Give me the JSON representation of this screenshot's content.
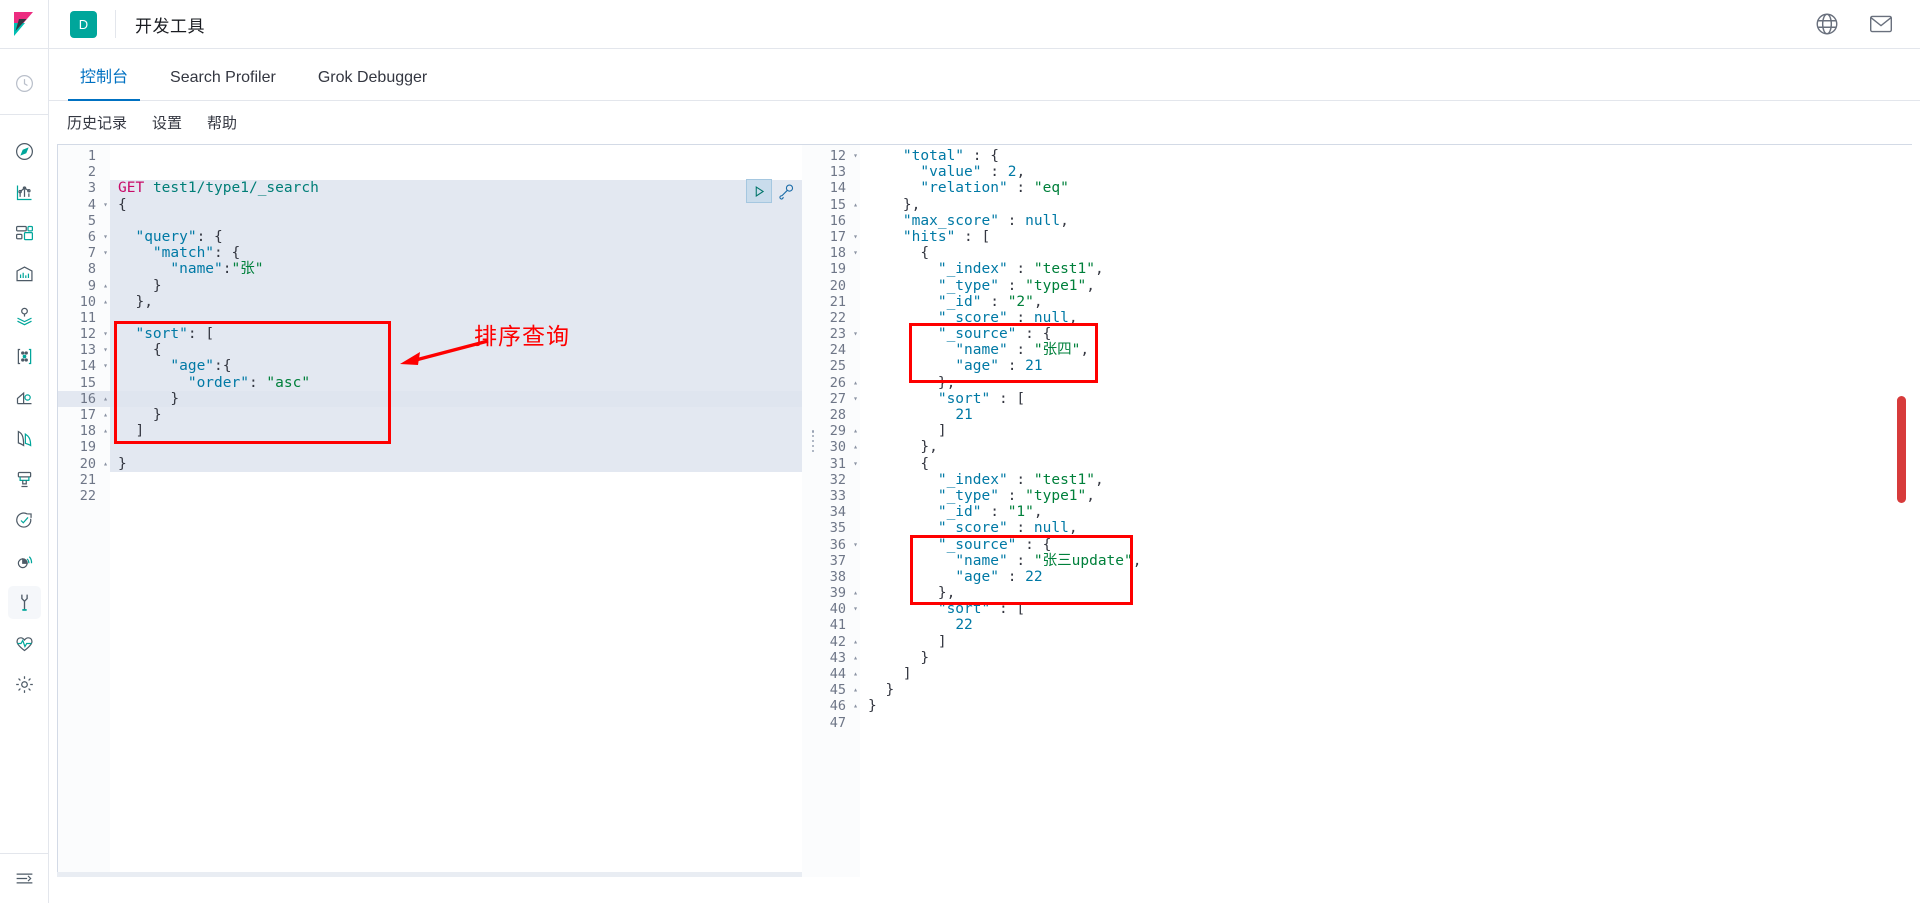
{
  "header": {
    "logo_icon": "kibana-logo",
    "space_badge": "D",
    "app_title": "开发工具",
    "right_icons": [
      {
        "name": "help-globe-icon",
        "glyph": "help"
      },
      {
        "name": "mail-icon",
        "glyph": "mail"
      }
    ]
  },
  "sidebar": {
    "recent_icon": "recently-viewed-clock-icon",
    "items": [
      {
        "name": "discover-icon",
        "label": "Discover"
      },
      {
        "name": "visualize-icon",
        "label": "Visualize"
      },
      {
        "name": "dashboard-icon",
        "label": "Dashboard"
      },
      {
        "name": "canvas-icon",
        "label": "Canvas"
      },
      {
        "name": "maps-icon",
        "label": "Maps"
      },
      {
        "name": "machine-learning-icon",
        "label": "Machine Learning"
      },
      {
        "name": "infrastructure-icon",
        "label": "Infrastructure"
      },
      {
        "name": "logs-icon",
        "label": "Logs"
      },
      {
        "name": "apm-icon",
        "label": "APM"
      },
      {
        "name": "uptime-icon",
        "label": "Uptime"
      },
      {
        "name": "siem-icon",
        "label": "SIEM"
      },
      {
        "name": "dev-tools-wrench-icon",
        "label": "开发工具",
        "active": true
      },
      {
        "name": "monitoring-heartbeat-icon",
        "label": "Monitoring"
      },
      {
        "name": "management-gear-icon",
        "label": "Management"
      }
    ],
    "collapse_icon": "collapse-menu-icon"
  },
  "tabs": [
    {
      "label": "控制台",
      "name": "tab-console",
      "active": true
    },
    {
      "label": "Search Profiler",
      "name": "tab-search-profiler",
      "active": false
    },
    {
      "label": "Grok Debugger",
      "name": "tab-grok-debugger",
      "active": false
    }
  ],
  "submenu": [
    {
      "label": "历史记录",
      "name": "submenu-history"
    },
    {
      "label": "设置",
      "name": "submenu-settings"
    },
    {
      "label": "帮助",
      "name": "submenu-help"
    }
  ],
  "request_editor": {
    "play_icon": "play-run-request-icon",
    "wrench_icon": "wrench-options-icon",
    "highlighted_line": 16,
    "lines": [
      {
        "n": 1,
        "fold": "",
        "text": ""
      },
      {
        "n": 2,
        "fold": "",
        "text": ""
      },
      {
        "n": 3,
        "fold": "",
        "text": "GET test1/type1/_search",
        "kind": "request"
      },
      {
        "n": 4,
        "fold": "v",
        "text": "{"
      },
      {
        "n": 5,
        "fold": "",
        "text": ""
      },
      {
        "n": 6,
        "fold": "v",
        "text": "  \"query\": {"
      },
      {
        "n": 7,
        "fold": "v",
        "text": "    \"match\": {"
      },
      {
        "n": 8,
        "fold": "",
        "text": "      \"name\":\"张\""
      },
      {
        "n": 9,
        "fold": "^",
        "text": "    }"
      },
      {
        "n": 10,
        "fold": "^",
        "text": "  },"
      },
      {
        "n": 11,
        "fold": "",
        "text": ""
      },
      {
        "n": 12,
        "fold": "v",
        "text": "  \"sort\": ["
      },
      {
        "n": 13,
        "fold": "v",
        "text": "    {"
      },
      {
        "n": 14,
        "fold": "v",
        "text": "      \"age\":{"
      },
      {
        "n": 15,
        "fold": "",
        "text": "        \"order\": \"asc\""
      },
      {
        "n": 16,
        "fold": "^",
        "text": "      }"
      },
      {
        "n": 17,
        "fold": "^",
        "text": "    }"
      },
      {
        "n": 18,
        "fold": "^",
        "text": "  ]"
      },
      {
        "n": 19,
        "fold": "",
        "text": ""
      },
      {
        "n": 20,
        "fold": "^",
        "text": "}"
      },
      {
        "n": 21,
        "fold": "",
        "text": ""
      },
      {
        "n": 22,
        "fold": "",
        "text": ""
      }
    ]
  },
  "response_editor": {
    "lines": [
      {
        "n": 12,
        "fold": "v",
        "text": "    \"total\" : {"
      },
      {
        "n": 13,
        "fold": "",
        "text": "      \"value\" : 2,"
      },
      {
        "n": 14,
        "fold": "",
        "text": "      \"relation\" : \"eq\""
      },
      {
        "n": 15,
        "fold": "^",
        "text": "    },"
      },
      {
        "n": 16,
        "fold": "",
        "text": "    \"max_score\" : null,"
      },
      {
        "n": 17,
        "fold": "v",
        "text": "    \"hits\" : ["
      },
      {
        "n": 18,
        "fold": "v",
        "text": "      {"
      },
      {
        "n": 19,
        "fold": "",
        "text": "        \"_index\" : \"test1\","
      },
      {
        "n": 20,
        "fold": "",
        "text": "        \"_type\" : \"type1\","
      },
      {
        "n": 21,
        "fold": "",
        "text": "        \"_id\" : \"2\","
      },
      {
        "n": 22,
        "fold": "",
        "text": "        \"_score\" : null,"
      },
      {
        "n": 23,
        "fold": "v",
        "text": "        \"_source\" : {"
      },
      {
        "n": 24,
        "fold": "",
        "text": "          \"name\" : \"张四\","
      },
      {
        "n": 25,
        "fold": "",
        "text": "          \"age\" : 21"
      },
      {
        "n": 26,
        "fold": "^",
        "text": "        },"
      },
      {
        "n": 27,
        "fold": "v",
        "text": "        \"sort\" : ["
      },
      {
        "n": 28,
        "fold": "",
        "text": "          21"
      },
      {
        "n": 29,
        "fold": "^",
        "text": "        ]"
      },
      {
        "n": 30,
        "fold": "^",
        "text": "      },"
      },
      {
        "n": 31,
        "fold": "v",
        "text": "      {"
      },
      {
        "n": 32,
        "fold": "",
        "text": "        \"_index\" : \"test1\","
      },
      {
        "n": 33,
        "fold": "",
        "text": "        \"_type\" : \"type1\","
      },
      {
        "n": 34,
        "fold": "",
        "text": "        \"_id\" : \"1\","
      },
      {
        "n": 35,
        "fold": "",
        "text": "        \"_score\" : null,"
      },
      {
        "n": 36,
        "fold": "v",
        "text": "        \"_source\" : {"
      },
      {
        "n": 37,
        "fold": "",
        "text": "          \"name\" : \"张三update\","
      },
      {
        "n": 38,
        "fold": "",
        "text": "          \"age\" : 22"
      },
      {
        "n": 39,
        "fold": "^",
        "text": "        },"
      },
      {
        "n": 40,
        "fold": "v",
        "text": "        \"sort\" : ["
      },
      {
        "n": 41,
        "fold": "",
        "text": "          22"
      },
      {
        "n": 42,
        "fold": "^",
        "text": "        ]"
      },
      {
        "n": 43,
        "fold": "^",
        "text": "      }"
      },
      {
        "n": 44,
        "fold": "^",
        "text": "    ]"
      },
      {
        "n": 45,
        "fold": "^",
        "text": "  }"
      },
      {
        "n": 46,
        "fold": "^",
        "text": "}"
      },
      {
        "n": 47,
        "fold": "",
        "text": ""
      }
    ]
  },
  "annotations": {
    "label": "排序查询",
    "color": "#fe0000",
    "boxes": [
      {
        "name": "annotation-box-sort-query"
      },
      {
        "name": "annotation-box-source-hit-1"
      },
      {
        "name": "annotation-box-source-hit-2"
      }
    ],
    "arrow_name": "annotation-arrow"
  },
  "colors": {
    "accent": "#0071c2",
    "teal": "#00a69b",
    "annotation_red": "#fe0000",
    "scrollbar_red": "#d73b3b"
  }
}
